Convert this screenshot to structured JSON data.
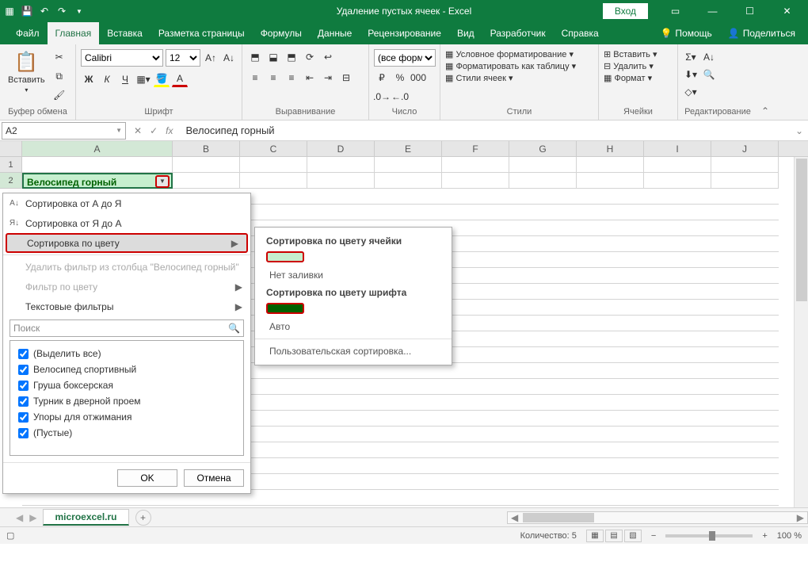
{
  "title": "Удаление пустых ячеек  -  Excel",
  "signin": "Вход",
  "tabs": [
    "Файл",
    "Главная",
    "Вставка",
    "Разметка страницы",
    "Формулы",
    "Данные",
    "Рецензирование",
    "Вид",
    "Разработчик",
    "Справка"
  ],
  "active_tab": 1,
  "help_search": "Помощь",
  "share": "Поделиться",
  "ribbon": {
    "clipboard": {
      "label": "Буфер обмена",
      "paste": "Вставить"
    },
    "font": {
      "label": "Шрифт",
      "family": "Calibri",
      "size": "12"
    },
    "alignment": {
      "label": "Выравнивание"
    },
    "number": {
      "label": "Число",
      "format": "(все форм"
    },
    "styles": {
      "label": "Стили",
      "cond": "Условное форматирование",
      "table": "Форматировать как таблицу",
      "cell": "Стили ячеек"
    },
    "cells": {
      "label": "Ячейки",
      "insert": "Вставить",
      "delete": "Удалить",
      "format": "Формат"
    },
    "editing": {
      "label": "Редактирование"
    }
  },
  "namebox": "A2",
  "formula": "Велосипед горный",
  "columns": [
    "A",
    "B",
    "C",
    "D",
    "E",
    "F",
    "G",
    "H",
    "I",
    "J"
  ],
  "row1": "1",
  "row2": "2",
  "cellA2": "Велосипед горный",
  "filter_menu": {
    "sort_az": "Сортировка от А до Я",
    "sort_za": "Сортировка от Я до А",
    "sort_color": "Сортировка по цвету",
    "clear": "Удалить фильтр из столбца \"Велосипед горный\"",
    "filter_color": "Фильтр по цвету",
    "text_filters": "Текстовые фильтры",
    "search_ph": "Поиск",
    "items": [
      "(Выделить все)",
      "Велосипед спортивный",
      "Груша боксерская",
      "Турник в дверной проем",
      "Упоры для отжимания",
      "(Пустые)"
    ],
    "ok": "OK",
    "cancel": "Отмена"
  },
  "submenu": {
    "by_cell": "Сортировка по цвету ячейки",
    "no_fill": "Нет заливки",
    "by_font": "Сортировка по цвету шрифта",
    "auto": "Авто",
    "custom": "Пользовательская сортировка..."
  },
  "sheet": "microexcel.ru",
  "status": {
    "count_lbl": "Количество:",
    "count": "5",
    "zoom": "100 %"
  }
}
